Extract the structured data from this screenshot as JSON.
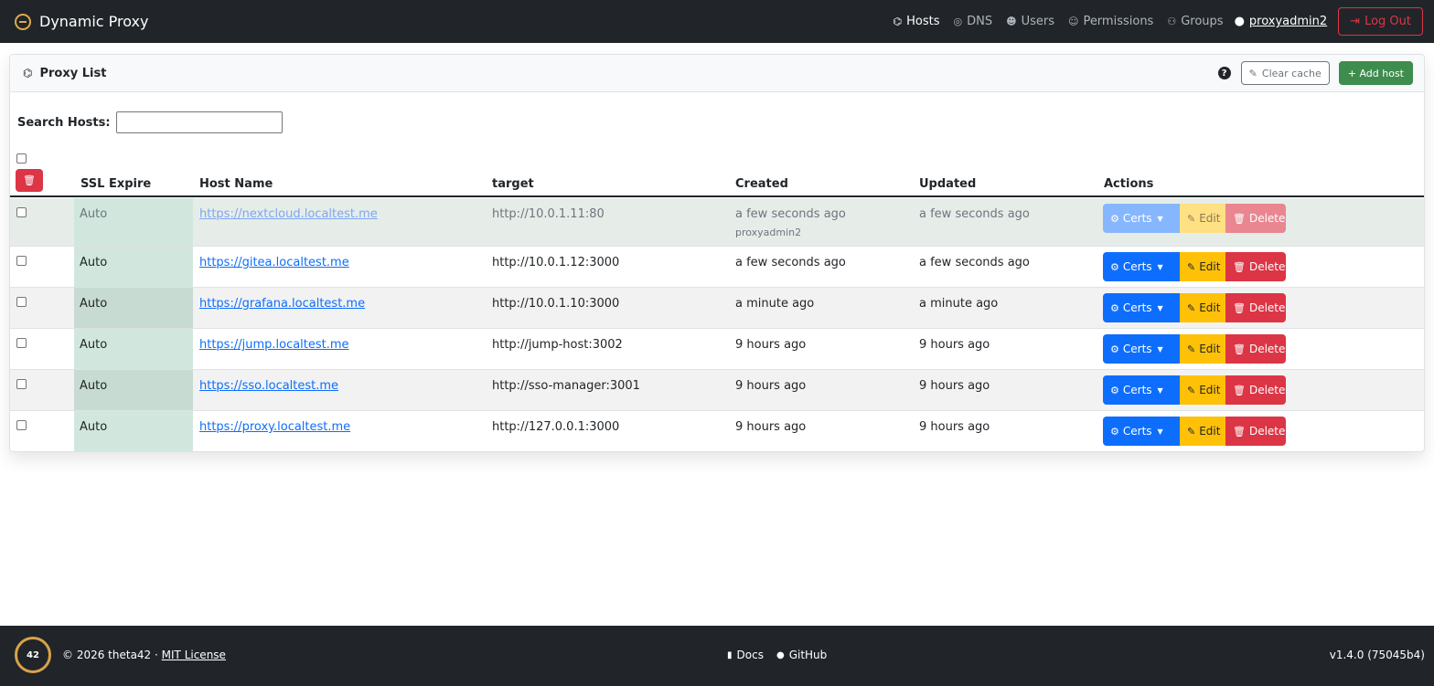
{
  "navbar": {
    "brand": "Dynamic Proxy",
    "links": [
      {
        "label": "Hosts",
        "icon": "sitemap-icon",
        "glyph": "⌬"
      },
      {
        "label": "DNS",
        "icon": "dns-icon",
        "glyph": "◎"
      },
      {
        "label": "Users",
        "icon": "users-icon",
        "glyph": "👥"
      },
      {
        "label": "Permissions",
        "icon": "user-lock-icon",
        "glyph": "🔐"
      },
      {
        "label": "Groups",
        "icon": "groups-icon",
        "glyph": "⚇"
      }
    ],
    "user": "proxyadmin2",
    "logout": "Log Out"
  },
  "card": {
    "title": "Proxy List",
    "help": "?",
    "clear_cache": "Clear cache",
    "add_host": "+ Add host"
  },
  "search": {
    "label": "Search Hosts:",
    "value": ""
  },
  "table": {
    "headers": {
      "ssl": "SSL Expire",
      "host": "Host Name",
      "target": "target",
      "created": "Created",
      "updated": "Updated",
      "actions": "Actions"
    },
    "rows": [
      {
        "ssl": "Auto",
        "host": "https://nextcloud.localtest.me",
        "target": "http://10.0.1.11:80",
        "created": "a few seconds ago",
        "created_by": "proxyadmin2",
        "updated": "a few seconds ago"
      },
      {
        "ssl": "Auto",
        "host": "https://gitea.localtest.me",
        "target": "http://10.0.1.12:3000",
        "created": "a few seconds ago",
        "created_by": "",
        "updated": "a few seconds ago"
      },
      {
        "ssl": "Auto",
        "host": "https://grafana.localtest.me",
        "target": "http://10.0.1.10:3000",
        "created": "a minute ago",
        "created_by": "",
        "updated": "a minute ago"
      },
      {
        "ssl": "Auto",
        "host": "https://jump.localtest.me",
        "target": "http://jump-host:3002",
        "created": "9 hours ago",
        "created_by": "",
        "updated": "9 hours ago"
      },
      {
        "ssl": "Auto",
        "host": "https://sso.localtest.me",
        "target": "http://sso-manager:3001",
        "created": "9 hours ago",
        "created_by": "",
        "updated": "9 hours ago"
      },
      {
        "ssl": "Auto",
        "host": "https://proxy.localtest.me",
        "target": "http://127.0.0.1:3000",
        "created": "9 hours ago",
        "created_by": "",
        "updated": "9 hours ago"
      }
    ],
    "action_labels": {
      "certs": "Certs",
      "edit": "Edit",
      "delete": "Delete"
    }
  },
  "footer": {
    "logo_text": "42",
    "copyright": "© 2026 theta42 ·",
    "license": "MIT License",
    "docs": "Docs",
    "github": "GitHub",
    "version": "v1.4.0 (75045b4)"
  }
}
